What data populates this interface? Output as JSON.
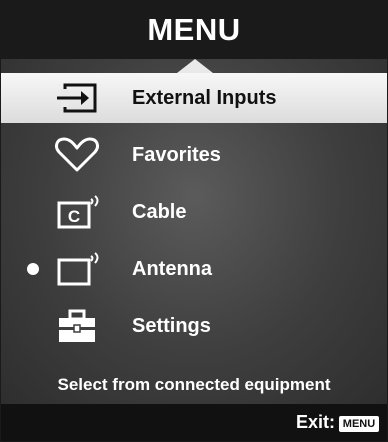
{
  "title": "MENU",
  "menu_items": [
    {
      "label": "External Inputs",
      "icon": "external-input-icon",
      "selected": true
    },
    {
      "label": "Favorites",
      "icon": "heart-icon",
      "selected": false
    },
    {
      "label": "Cable",
      "icon": "cable-tv-icon",
      "icon_text": "C",
      "selected": false
    },
    {
      "label": "Antenna",
      "icon": "antenna-tv-icon",
      "selected": false,
      "active": true
    },
    {
      "label": "Settings",
      "icon": "toolbox-icon",
      "selected": false
    }
  ],
  "hint": "Select from connected equipment",
  "footer": {
    "exit_label": "Exit:",
    "key_label": "MENU"
  }
}
